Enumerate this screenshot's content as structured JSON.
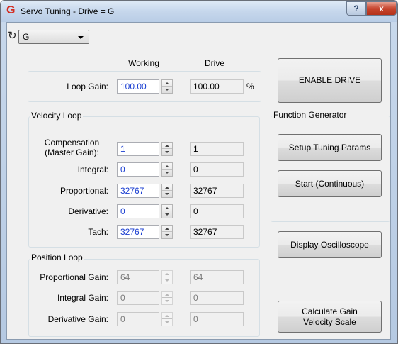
{
  "window": {
    "title": "Servo Tuning - Drive = G",
    "app_icon": "G",
    "help_label": "?",
    "close_label": "x"
  },
  "toolbar": {
    "drive_select": "G",
    "refresh_icon": "↻"
  },
  "columns": {
    "working": "Working",
    "drive": "Drive"
  },
  "loop_gain": {
    "label": "Loop Gain:",
    "working": "100.00",
    "drive": "100.00",
    "unit": "%"
  },
  "velocity_loop": {
    "title": "Velocity Loop",
    "rows": [
      {
        "label_line1": "Compensation",
        "label_line2": "(Master Gain):",
        "working": "1",
        "drive": "1"
      },
      {
        "label": "Integral:",
        "working": "0",
        "drive": "0"
      },
      {
        "label": "Proportional:",
        "working": "32767",
        "drive": "32767"
      },
      {
        "label": "Derivative:",
        "working": "0",
        "drive": "0"
      },
      {
        "label": "Tach:",
        "working": "32767",
        "drive": "32767"
      }
    ]
  },
  "position_loop": {
    "title": "Position Loop",
    "rows": [
      {
        "label": "Proportional Gain:",
        "working": "64",
        "drive": "64"
      },
      {
        "label": "Integral Gain:",
        "working": "0",
        "drive": "0"
      },
      {
        "label": "Derivative Gain:",
        "working": "0",
        "drive": "0"
      }
    ]
  },
  "buttons": {
    "enable_drive": "ENABLE DRIVE",
    "setup_tuning": "Setup Tuning Params",
    "start_continuous": "Start (Continuous)",
    "display_oscilloscope": "Display Oscilloscope",
    "calc_line1": "Calculate Gain",
    "calc_line2": "Velocity Scale"
  },
  "function_generator": {
    "title": "Function Generator"
  },
  "colors": {
    "working_value": "#1a3ed1",
    "titlebar": "#c6d7ec",
    "close_button": "#c7452e"
  }
}
